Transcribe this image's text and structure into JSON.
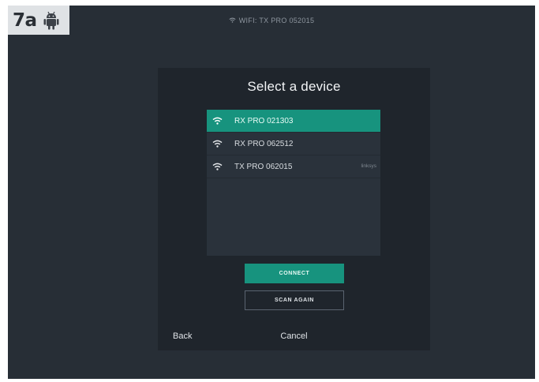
{
  "step_label": {
    "number": "7a",
    "platform_icon": "android-icon"
  },
  "status_bar": {
    "icon": "wifi-icon",
    "text": "WIFI: TX PRO 052015"
  },
  "dialog": {
    "title": "Select a device",
    "devices": [
      {
        "name": "RX PRO 021303",
        "note": "",
        "icon": "wifi-icon",
        "selected": true
      },
      {
        "name": "RX PRO 062512",
        "note": "",
        "icon": "wifi-icon",
        "selected": false
      },
      {
        "name": "TX PRO 062015",
        "note": "linksys",
        "icon": "wifi-icon",
        "selected": false
      }
    ],
    "connect_label": "CONNECT",
    "scan_label": "SCAN AGAIN",
    "back_label": "Back",
    "cancel_label": "Cancel"
  },
  "colors": {
    "screen_bg": "#272e36",
    "dialog_bg": "#1f252c",
    "accent": "#17937e",
    "list_bg": "#2a323b"
  }
}
